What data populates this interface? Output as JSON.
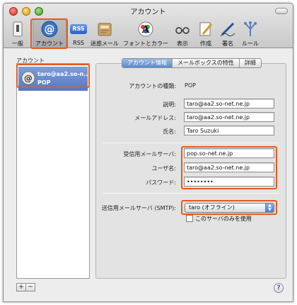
{
  "window": {
    "title": "アカウント"
  },
  "toolbar": {
    "items": [
      {
        "id": "general",
        "label": "一般",
        "icon": "switch-icon"
      },
      {
        "id": "accounts",
        "label": "アカウント",
        "icon": "at-sign-icon"
      },
      {
        "id": "rss",
        "label": "RSS",
        "icon": "rss-icon",
        "icon_text": "RSS"
      },
      {
        "id": "junk",
        "label": "迷惑メール",
        "icon": "junk-mail-icon"
      },
      {
        "id": "fonts",
        "label": "フォントとカラー",
        "icon": "fonts-colors-icon"
      },
      {
        "id": "viewing",
        "label": "表示",
        "icon": "eyeglasses-icon"
      },
      {
        "id": "composing",
        "label": "作成",
        "icon": "compose-pencil-icon"
      },
      {
        "id": "signatures",
        "label": "署名",
        "icon": "signature-pen-icon"
      },
      {
        "id": "rules",
        "label": "ルール",
        "icon": "rules-icon"
      }
    ],
    "selected": "accounts"
  },
  "sidebar": {
    "header": "アカウント",
    "accounts": [
      {
        "name": "taro@aa2.so-n...",
        "type": "POP"
      }
    ],
    "add_label": "+",
    "remove_label": "−"
  },
  "help": {
    "label": "?"
  },
  "tabs": [
    "アカウント情報",
    "メールボックスの特性",
    "詳細"
  ],
  "active_tab": "アカウント情報",
  "form": {
    "account_type_label": "アカウントの種類:",
    "account_type_value": "POP",
    "description_label": "説明:",
    "description_value": "taro@aa2.so-net.ne.jp",
    "email_label": "メールアドレス:",
    "email_value": "taro@aa2.so-net.ne.jp",
    "fullname_label": "氏名:",
    "fullname_value": "Taro Suzuki",
    "incoming_server_label": "受信用メールサーバ:",
    "incoming_server_value": "pop.so-net.ne.jp",
    "username_label": "ユーザ名:",
    "username_value": "taro@aa2.so-net.ne.jp",
    "password_label": "パスワード:",
    "password_value": "••••••••",
    "smtp_label": "送信用メールサーバ (SMTP):",
    "smtp_value": "taro (オフライン)",
    "smtp_only_label": "このサーバのみを使用"
  },
  "colors": {
    "highlight": "#e85a1b",
    "selection": "#5577c2"
  }
}
